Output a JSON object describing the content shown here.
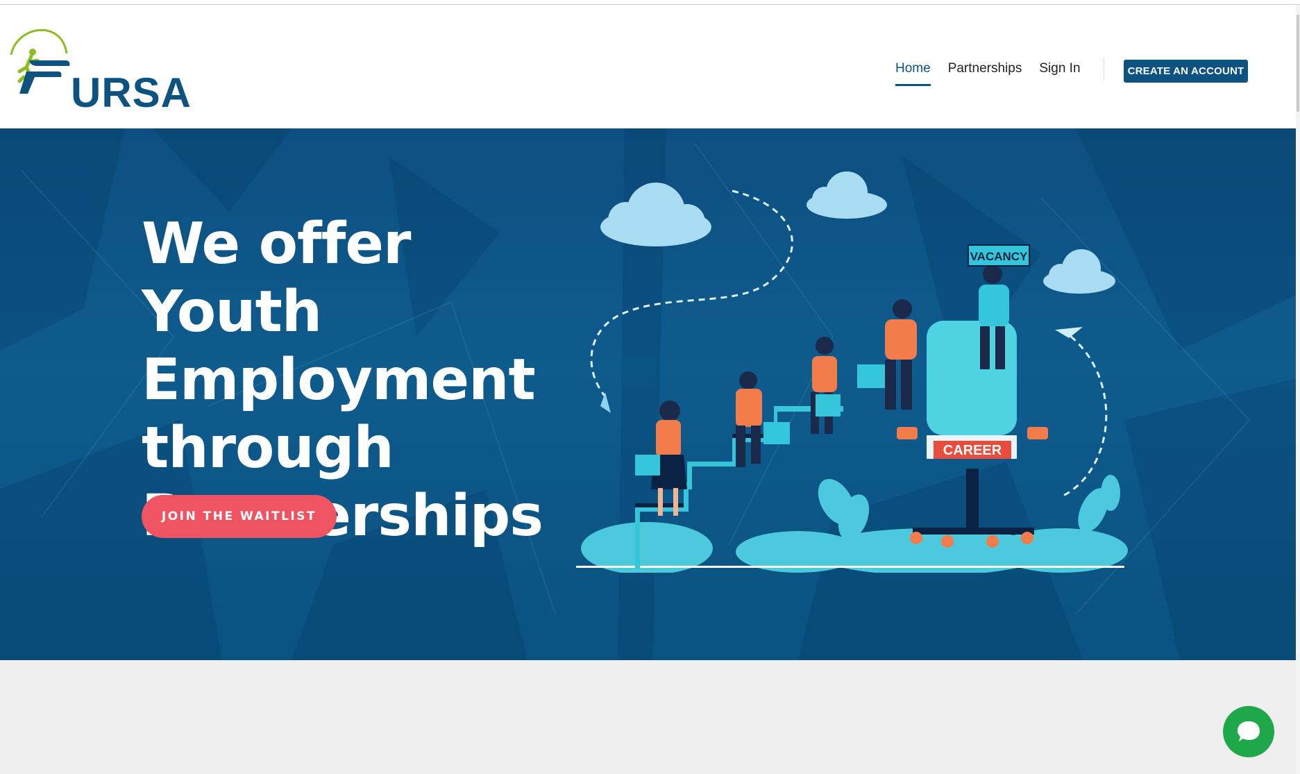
{
  "brand": {
    "name": "URSA",
    "colors": {
      "primary": "#0d5382",
      "accent": "#f05463",
      "green": "#8dbd1f",
      "chat": "#1fa84a"
    }
  },
  "nav": {
    "items": [
      {
        "label": "Home",
        "active": true
      },
      {
        "label": "Partnerships",
        "active": false
      },
      {
        "label": "Sign In",
        "active": false
      }
    ],
    "cta_label": "CREATE AN ACCOUNT"
  },
  "hero": {
    "headline": "We offer Youth Employment through Partnerships",
    "button_label": "JOIN THE WAITLIST",
    "illustration": {
      "sign_text": "VACANCY",
      "chair_text": "CAREER"
    }
  },
  "chat": {
    "icon": "chat-bubble-icon"
  }
}
